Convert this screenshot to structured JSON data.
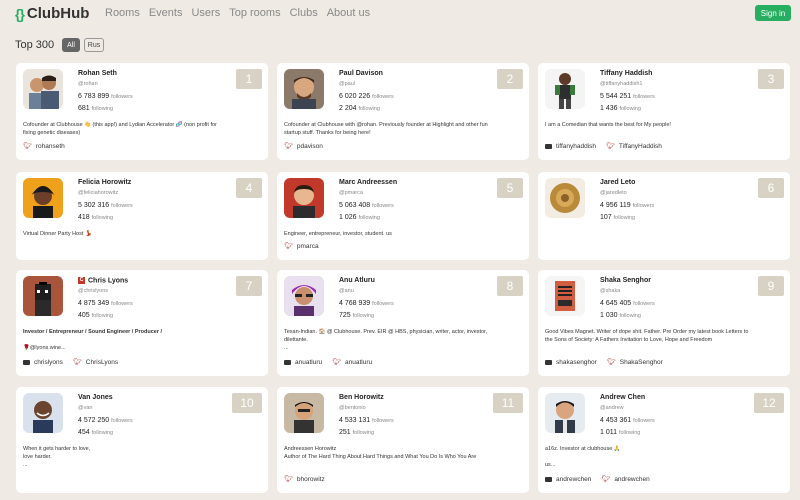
{
  "nav": {
    "logo_mark": "{}",
    "logo_text": "ClubHub",
    "links": [
      "Rooms",
      "Events",
      "Users",
      "Top rooms",
      "Clubs",
      "About us"
    ],
    "signin": "Sign in"
  },
  "heading": "Top 300",
  "filters": [
    "All",
    "Rus"
  ],
  "cards": [
    {
      "name": "Rohan Seth",
      "handle": "@rohan",
      "followers": "6 783 899",
      "following": "681",
      "rank": "1",
      "bio": [
        "Cofounder at Clubhouse 👋 (this app!) and Lydian Accelerator 🧬 (non profit for",
        "fixing genetic diseases)"
      ],
      "instagram": "",
      "twitter": "rohanseth"
    },
    {
      "name": "Paul Davison",
      "handle": "@paul",
      "followers": "6 020 226",
      "following": "2 204",
      "rank": "2",
      "bio": [
        "Cofounder at Clubhouse with @rohan. Previously founder at Highlight and other fun",
        "startup stuff. Thanks for being here!"
      ],
      "instagram": "",
      "twitter": "pdavison"
    },
    {
      "name": "Tiffany Haddish",
      "handle": "@tiffanyhaddish1",
      "followers": "5 544 251",
      "following": "1 436",
      "rank": "3",
      "bio": [
        "I am a Comedian that wants the best for My people!"
      ],
      "instagram": "tiffanyhaddish",
      "twitter": "TiffanyHaddish"
    },
    {
      "name": "Felicia Horowitz",
      "handle": "@feliciahorowitz",
      "followers": "5 302 316",
      "following": "418",
      "rank": "4",
      "bio": [
        "Virtual Dinner Party Host 💃"
      ],
      "instagram": "",
      "twitter": ""
    },
    {
      "name": "Marc Andreessen",
      "handle": "@pmarca",
      "followers": "5 063 408",
      "following": "1 026",
      "rank": "5",
      "bio": [
        "Engineer, entrepreneur, investor, student. us"
      ],
      "instagram": "",
      "twitter": "pmarca"
    },
    {
      "name": "Jared Leto",
      "handle": "@jaredleto",
      "followers": "4 956 119",
      "following": "107",
      "rank": "6",
      "bio": [],
      "instagram": "",
      "twitter": ""
    },
    {
      "name": "Chris Lyons",
      "name_badge": "C",
      "handle": "@chrislyons",
      "followers": "4 875 349",
      "following": "405",
      "rank": "7",
      "bio": [
        "Investor / Entrepreneur / Sound Engineer / Producer /",
        "",
        "🌹@lyons.wine..."
      ],
      "instagram": "chrislyons",
      "twitter": "ChrisLyons"
    },
    {
      "name": "Anu Atluru",
      "handle": "@anu",
      "followers": "4 768 939",
      "following": "725",
      "rank": "8",
      "bio": [
        "Texan-Indian. 🏠 @ Clubhouse. Prev. EIR @ HBS, physician, writer, actor, investor,",
        "dilettante.",
        "..."
      ],
      "instagram": "anuatluru",
      "twitter": "anuatluru"
    },
    {
      "name": "Shaka Senghor",
      "handle": "@shaka",
      "followers": "4 645 405",
      "following": "1 030",
      "rank": "9",
      "bio": [
        "Good Vibes Magnet. Writer of dope shit. Father. Pre Order my latest book Letters to",
        "the Sons of Society: A Fathers Invitation to Love, Hope and Freedom"
      ],
      "instagram": "shakasenghor",
      "twitter": "ShakaSenghor"
    },
    {
      "name": "Van Jones",
      "handle": "@van",
      "followers": "4 572 250",
      "following": "454",
      "rank": "10",
      "bio": [
        "When it gets harder to love,",
        "love harder.",
        "..."
      ],
      "instagram": "",
      "twitter": ""
    },
    {
      "name": "Ben Horowitz",
      "handle": "@bentonio",
      "followers": "4 533 131",
      "following": "251",
      "rank": "11",
      "bio": [
        "Andreessen Horowitz",
        "Author of The Hard Thing About Hard Things and What You Do Is Who You Are"
      ],
      "instagram": "",
      "twitter": "bhorowitz"
    },
    {
      "name": "Andrew Chen",
      "handle": "@andrew",
      "followers": "4 453 361",
      "following": "1 011",
      "rank": "12",
      "bio": [
        "a16z. Investor at clubhouse 🙏",
        "",
        "us..."
      ],
      "instagram": "andrewchen",
      "twitter": "andrewchen"
    }
  ],
  "labels": {
    "followers": "followers",
    "following": "following"
  },
  "colors": {
    "background": "#efebe4",
    "brand": "#27ae60",
    "rank_badge": "#d7d2c4",
    "twitter_icon": "#b22222"
  }
}
